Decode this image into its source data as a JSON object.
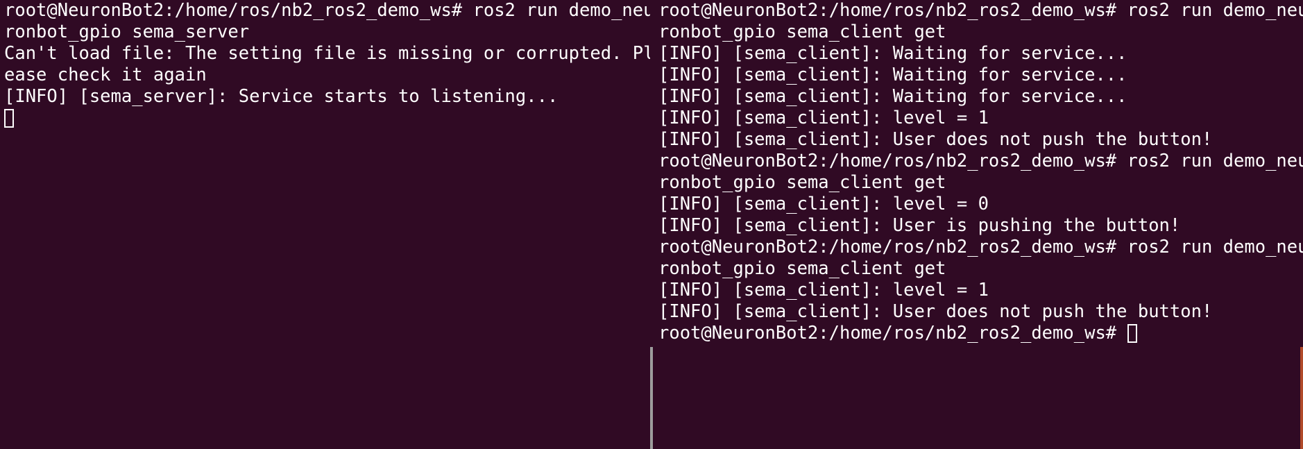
{
  "colors": {
    "background": "#300a24",
    "text": "#ffffff",
    "divider": "#9d9d9d",
    "edge_accent": "#b04a2a"
  },
  "left_pane": {
    "lines": [
      "root@NeuronBot2:/home/ros/nb2_ros2_demo_ws# ros2 run demo_neu",
      "ronbot_gpio sema_server",
      "Can't load file: The setting file is missing or corrupted. Pl",
      "ease check it again",
      "[INFO] [sema_server]: Service starts to listening..."
    ]
  },
  "right_pane": {
    "lines": [
      "root@NeuronBot2:/home/ros/nb2_ros2_demo_ws# ros2 run demo_neu",
      "ronbot_gpio sema_client get",
      "[INFO] [sema_client]: Waiting for service...",
      "[INFO] [sema_client]: Waiting for service...",
      "[INFO] [sema_client]: Waiting for service...",
      "[INFO] [sema_client]: level = 1",
      "[INFO] [sema_client]: User does not push the button!",
      "root@NeuronBot2:/home/ros/nb2_ros2_demo_ws# ros2 run demo_neu",
      "ronbot_gpio sema_client get",
      "[INFO] [sema_client]: level = 0",
      "[INFO] [sema_client]: User is pushing the button!",
      "root@NeuronBot2:/home/ros/nb2_ros2_demo_ws# ros2 run demo_neu",
      "ronbot_gpio sema_client get",
      "[INFO] [sema_client]: level = 1",
      "[INFO] [sema_client]: User does not push the button!"
    ],
    "prompt": "root@NeuronBot2:/home/ros/nb2_ros2_demo_ws# "
  }
}
